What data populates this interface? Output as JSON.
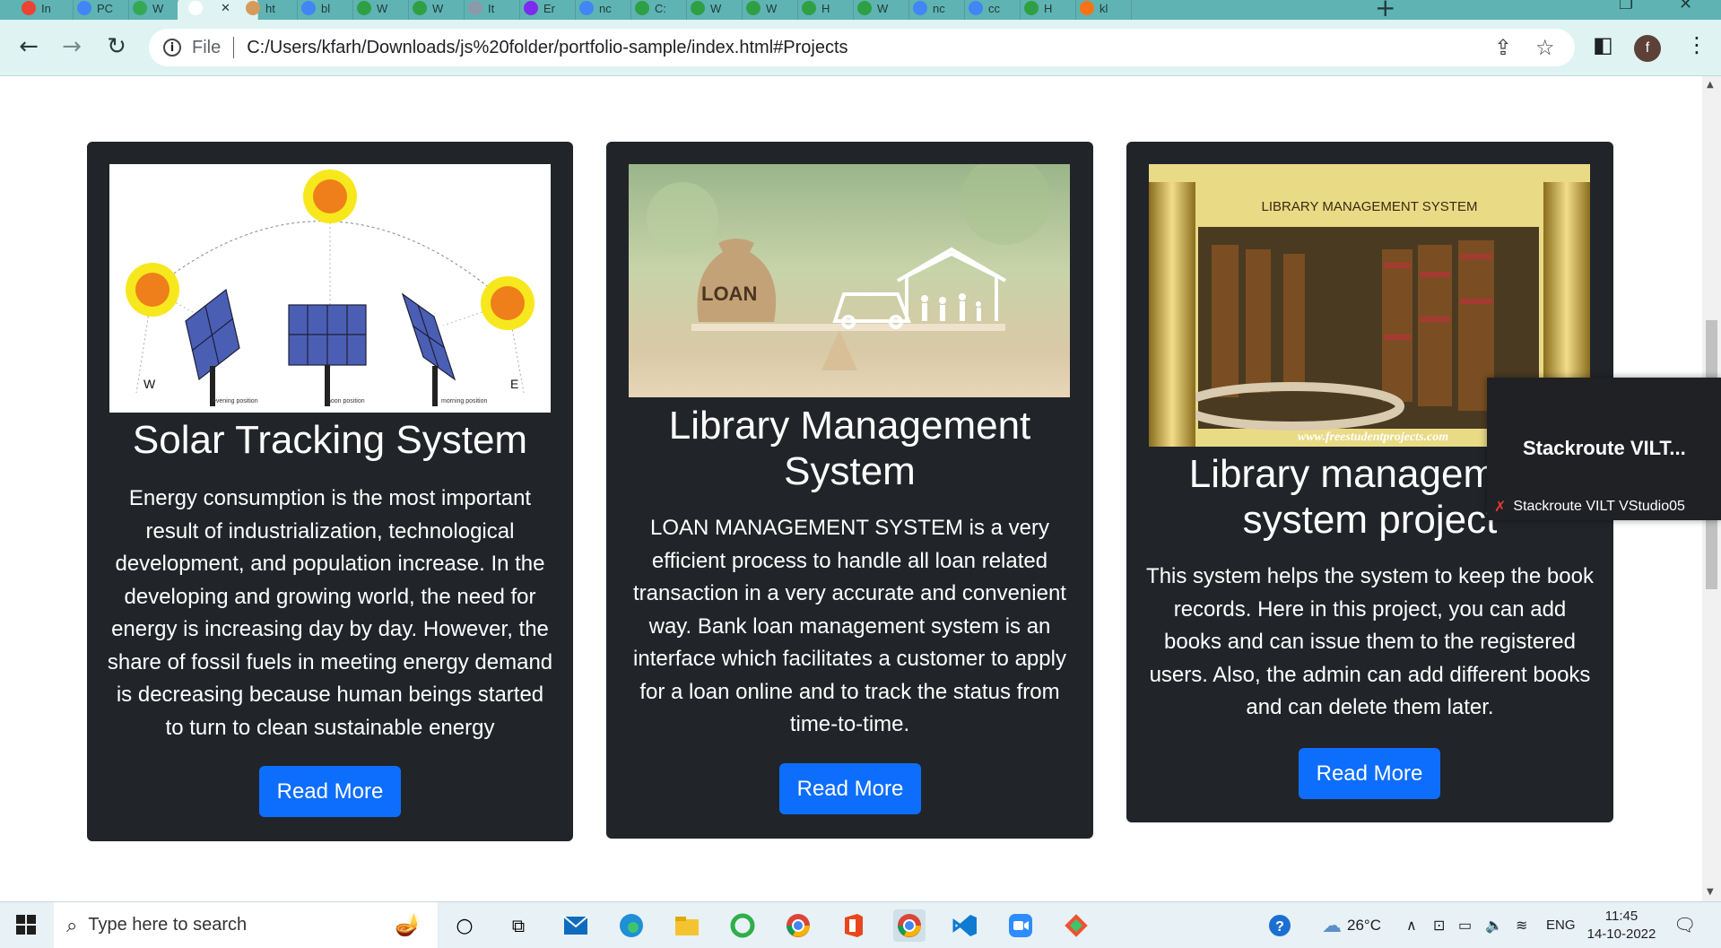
{
  "browser": {
    "tabs": [
      {
        "label": "In",
        "color": "#ea4335"
      },
      {
        "label": "PC",
        "color": "#4285f4"
      },
      {
        "label": "W",
        "color": "#34a853"
      },
      {
        "label": "",
        "color": "#ffffff",
        "active": true
      },
      {
        "label": "ht",
        "color": "#d69b5a"
      },
      {
        "label": "bl",
        "color": "#4285f4"
      },
      {
        "label": "W",
        "color": "#2ea043"
      },
      {
        "label": "W",
        "color": "#2ea043"
      },
      {
        "label": "It",
        "color": "#8a9aa8"
      },
      {
        "label": "Er",
        "color": "#7b2cf0"
      },
      {
        "label": "nc",
        "color": "#4285f4"
      },
      {
        "label": "C:",
        "color": "#2ea043"
      },
      {
        "label": "W",
        "color": "#2ea043"
      },
      {
        "label": "W",
        "color": "#2ea043"
      },
      {
        "label": "H",
        "color": "#2ea043"
      },
      {
        "label": "W",
        "color": "#2ea043"
      },
      {
        "label": "nc",
        "color": "#4285f4"
      },
      {
        "label": "cc",
        "color": "#4285f4"
      },
      {
        "label": "H",
        "color": "#2ea043"
      },
      {
        "label": "kl",
        "color": "#f97316"
      }
    ],
    "new_tab": "+",
    "scheme": "File",
    "url": "C:/Users/kfarh/Downloads/js%20folder/portfolio-sample/index.html#Projects",
    "avatar_letter": "f"
  },
  "projects": [
    {
      "title": "Solar Tracking System",
      "description": "Energy consumption is the most important result of industrialization, technological development, and population increase. In the developing and growing world, the need for energy is increasing day by day. However, the share of fossil fuels in meeting energy demand is decreasing because human beings started to turn to clean sustainable energy",
      "button": "Read More",
      "image_labels": {
        "west": "W",
        "east": "E",
        "evening": "evening position",
        "noon": "noon position",
        "morning": "morning position"
      }
    },
    {
      "title": "Library Management System",
      "description": "LOAN MANAGEMENT SYSTEM is a very efficient process to handle all loan related transaction in a very accurate and convenient way. Bank loan management system is an interface which facilitates a customer to apply for a loan online and to track the status from time-to-time.",
      "button": "Read More",
      "image_labels": {
        "bag": "LOAN"
      }
    },
    {
      "title": "Library management system project",
      "description": "This system helps the system to keep the book records. Here in this project, you can add books and can issue them to the registered users. Also, the admin can add different books and can delete them later.",
      "button": "Read More",
      "image_labels": {
        "banner": "LIBRARY MANAGEMENT SYSTEM",
        "site": "www.freestudentprojects.com"
      }
    }
  ],
  "overlay": {
    "title": "Stackroute VILT...",
    "subtitle": "Stackroute VILT VStudio05"
  },
  "taskbar": {
    "search_placeholder": "Type here to search",
    "weather": "26°C",
    "language": "ENG",
    "time": "11:45",
    "date": "14-10-2022"
  }
}
